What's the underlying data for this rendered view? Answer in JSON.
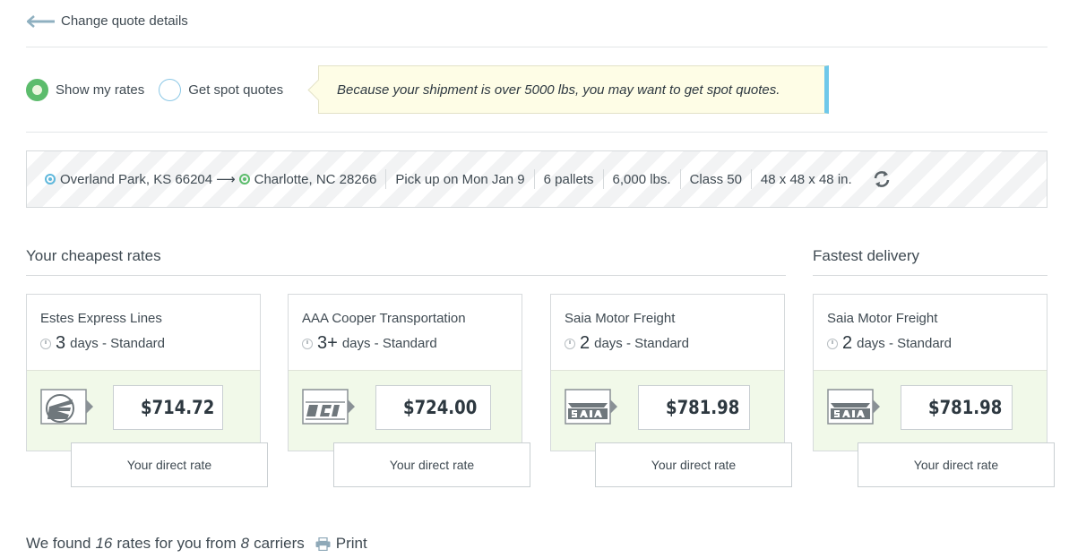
{
  "back_link": {
    "label": "Change quote details",
    "icon": "arrow-left-icon"
  },
  "rate_mode": {
    "options": [
      {
        "label": "Show my rates",
        "selected": true
      },
      {
        "label": "Get spot quotes",
        "selected": false
      }
    ]
  },
  "notice": {
    "text": "Because your shipment is over 5000 lbs, you may want to get spot quotes."
  },
  "route": {
    "origin": "Overland Park, KS 66204",
    "destination": "Charlotte, NC 28266",
    "pickup": "Pick up on Mon Jan 9",
    "pallets": "6 pallets",
    "weight": "6,000 lbs.",
    "class": "Class 50",
    "dimensions": "48 x 48 x 48 in.",
    "refresh_icon": "refresh-icon"
  },
  "sections": {
    "cheapest": "Your cheapest rates",
    "fastest": "Fastest delivery"
  },
  "cards": [
    {
      "carrier": "Estes Express Lines",
      "days": "3",
      "service": "days - Standard",
      "price": "$714.72",
      "direct": "Your direct rate",
      "logo": "estes-logo"
    },
    {
      "carrier": "AAA Cooper Transportation",
      "days": "3+",
      "service": "days - Standard",
      "price": "$724.00",
      "direct": "Your direct rate",
      "logo": "aaa-cooper-logo"
    },
    {
      "carrier": "Saia Motor Freight",
      "days": "2",
      "service": "days - Standard",
      "price": "$781.98",
      "direct": "Your direct rate",
      "logo": "saia-logo"
    },
    {
      "carrier": "Saia Motor Freight",
      "days": "2",
      "service": "days - Standard",
      "price": "$781.98",
      "direct": "Your direct rate",
      "logo": "saia-logo"
    }
  ],
  "summary": {
    "prefix": "We found",
    "rates_count": "16",
    "middle": "rates for you from",
    "carriers_count": "8",
    "suffix": "carriers",
    "print_label": "Print"
  },
  "colors": {
    "accent_green": "#5cbc6c",
    "accent_blue": "#6ec8ea",
    "card_bottom": "#f1f9e9",
    "notice_bg": "#fefde6"
  }
}
